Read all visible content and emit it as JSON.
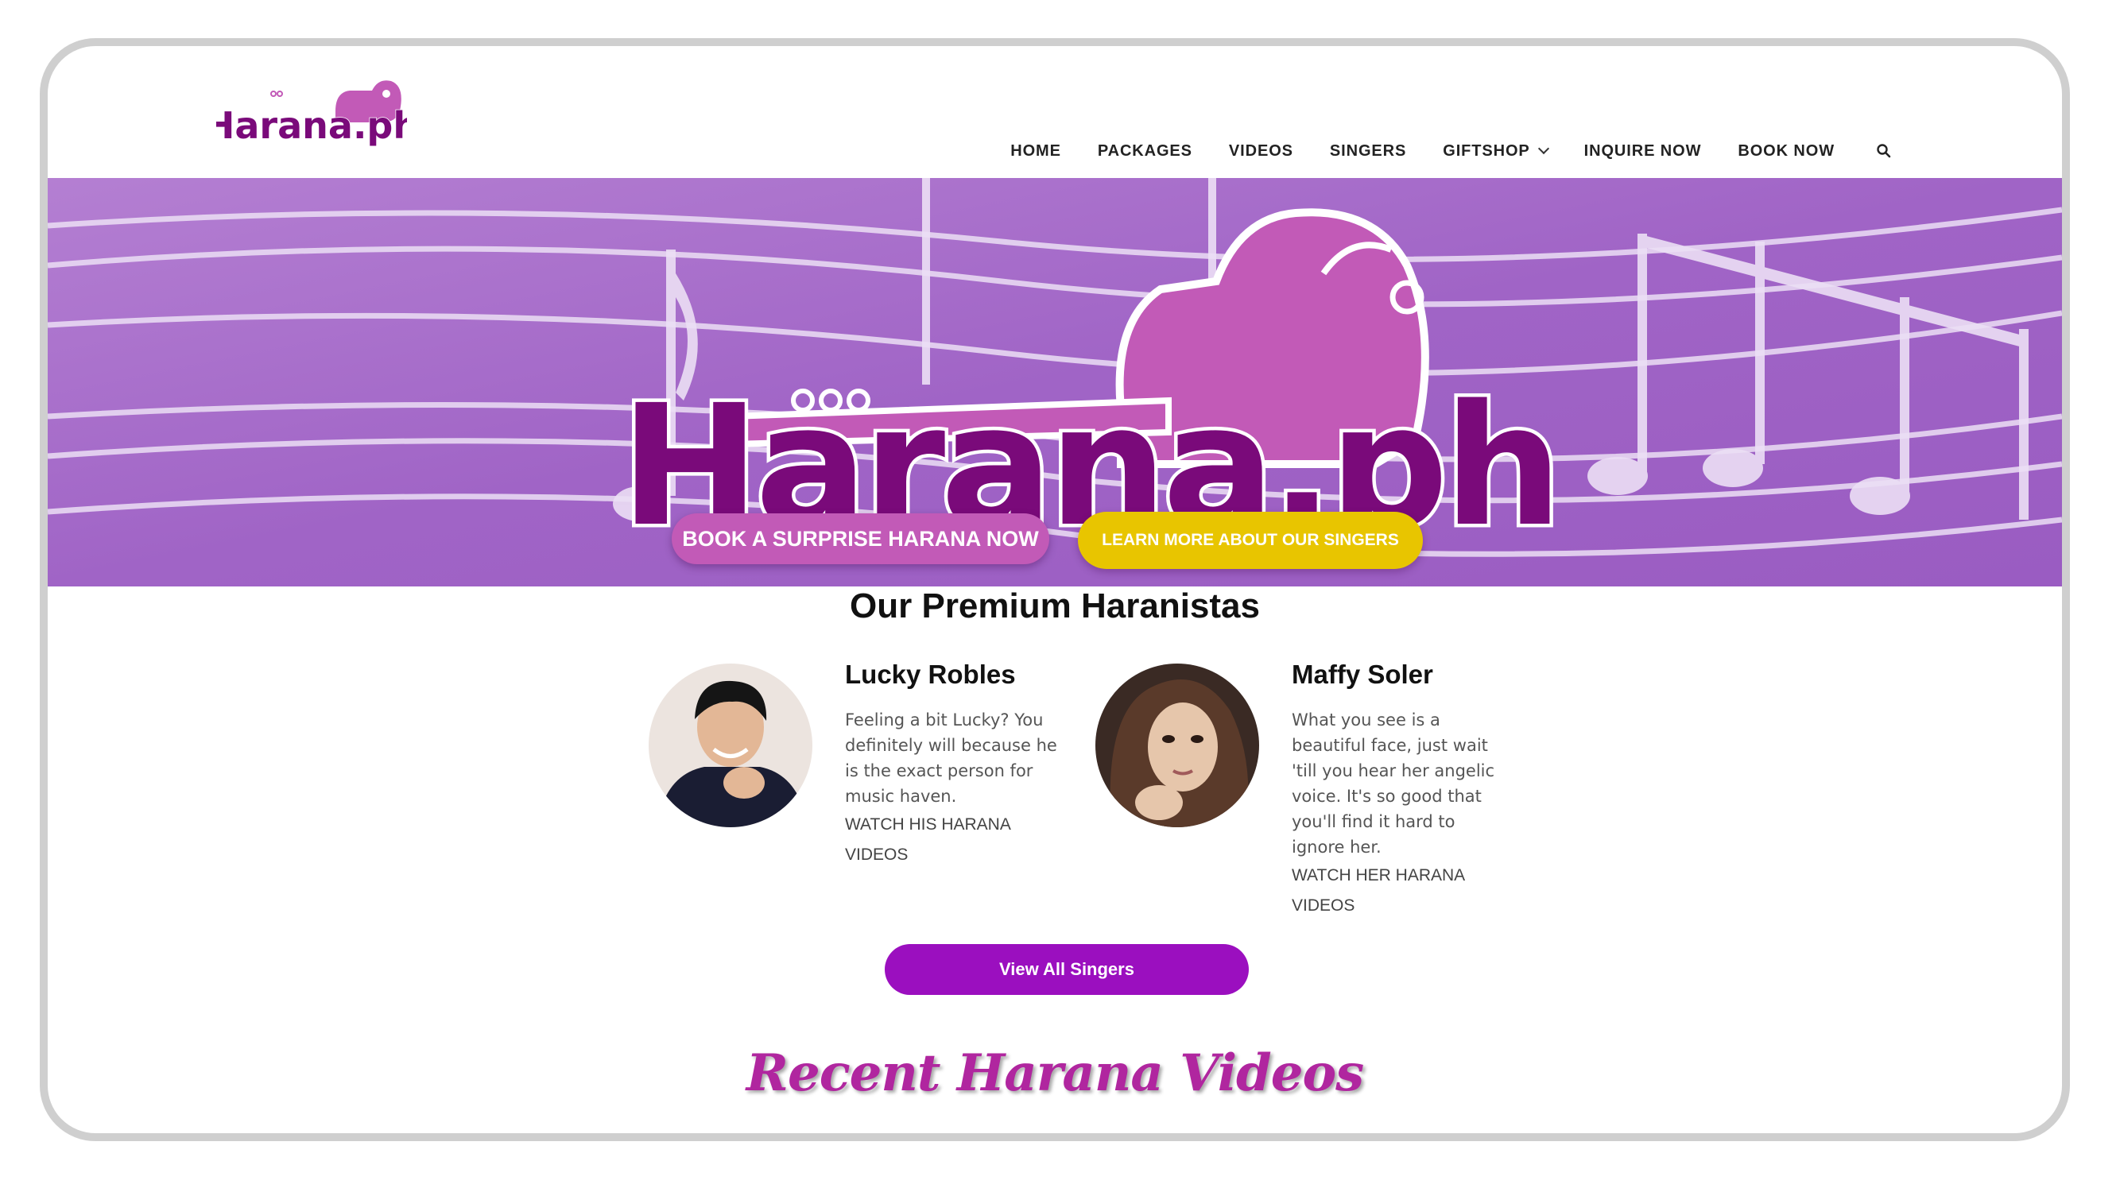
{
  "brand": {
    "logo_text": "Härana.ph",
    "colors": {
      "purple_dark": "#7a0a7a",
      "purple_light": "#c25ab7",
      "accent_yellow": "#e8c500",
      "button_purple": "#9b0fbf"
    }
  },
  "nav": {
    "items": [
      {
        "label": "HOME"
      },
      {
        "label": "PACKAGES"
      },
      {
        "label": "VIDEOS"
      },
      {
        "label": "SINGERS"
      },
      {
        "label": "GIFTSHOP",
        "has_dropdown": true
      },
      {
        "label": "INQUIRE NOW"
      },
      {
        "label": "BOOK NOW"
      }
    ],
    "search_icon": "search-icon"
  },
  "hero": {
    "book_button": "BOOK A SURPRISE HARANA NOW",
    "learn_button": "LEARN MORE ABOUT OUR SINGERS"
  },
  "singers_section": {
    "title": "Our Premium Haranistas",
    "singers": [
      {
        "name": "Lucky Robles",
        "description": [
          "Feeling a bit Lucky? You",
          "definitely will because he",
          "is the exact person for",
          "music haven."
        ],
        "link": [
          "WATCH HIS HARANA",
          "VIDEOS"
        ]
      },
      {
        "name": "Maffy Soler",
        "description": [
          "What you see is a",
          "beautiful face, just wait",
          "'till you hear her angelic",
          "voice. It's so good that",
          "you'll find it hard to",
          "ignore her."
        ],
        "link": [
          "WATCH HER HARANA",
          "VIDEOS"
        ]
      }
    ],
    "view_all_button": "View All Singers"
  },
  "videos_section": {
    "title": "Recent Harana Videos"
  }
}
